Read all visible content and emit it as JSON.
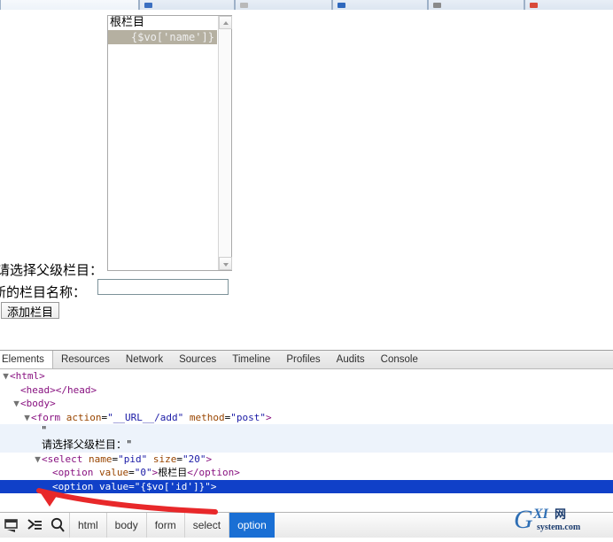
{
  "browser": {
    "tabs": [
      {
        "favicon_color": "#5a7fc4"
      },
      {
        "favicon_color": "#3b6fc0"
      },
      {
        "favicon_color": "#b9b9b9"
      },
      {
        "favicon_color": "#2f68bd"
      },
      {
        "favicon_color": "#8a8a8a"
      },
      {
        "favicon_color": "#d94a3a"
      },
      {
        "favicon_color": "#4d79bf"
      }
    ]
  },
  "page": {
    "select": {
      "name": "pid",
      "size": "20",
      "options": [
        {
          "label": "根栏目",
          "value": "0",
          "selected": false
        },
        {
          "label": "{$vo['name']}",
          "value": "{$vo['id']}",
          "selected": true
        }
      ],
      "scroll_up_icon": "chevron-up-icon",
      "scroll_down_icon": "chevron-down-icon"
    },
    "label_parent": "请选择父级栏目：",
    "label_name": "新的栏目名称：",
    "input_name_value": "",
    "input_name_placeholder": "",
    "submit_label": "添加栏目"
  },
  "devtools": {
    "tabs": [
      {
        "label": "Elements",
        "active": true
      },
      {
        "label": "Resources",
        "active": false
      },
      {
        "label": "Network",
        "active": false
      },
      {
        "label": "Sources",
        "active": false
      },
      {
        "label": "Timeline",
        "active": false
      },
      {
        "label": "Profiles",
        "active": false
      },
      {
        "label": "Audits",
        "active": false
      },
      {
        "label": "Console",
        "active": false
      }
    ],
    "dom_lines": [
      {
        "indent": 0,
        "twisty": "▼",
        "html": "<span class=\"tagp\">&lt;html&gt;</span>",
        "state": "none"
      },
      {
        "indent": 1,
        "twisty": "",
        "html": "<span class=\"tagp\">&lt;head&gt;&lt;/head&gt;</span>",
        "state": "none"
      },
      {
        "indent": 1,
        "twisty": "▼",
        "html": "<span class=\"tagp\">&lt;body&gt;</span>",
        "state": "none"
      },
      {
        "indent": 2,
        "twisty": "▼",
        "html": "<span class=\"tagp\">&lt;form</span> <span class=\"attn\">action</span>=<span class=\"attv\">\"__URL__/add\"</span> <span class=\"attn\">method</span>=<span class=\"attv\">\"post\"</span><span class=\"tagp\">&gt;</span>",
        "state": "none"
      },
      {
        "indent": 3,
        "twisty": "",
        "html": "<span class=\"txtnode\">\"</span>",
        "state": "text"
      },
      {
        "indent": 3,
        "twisty": "",
        "html": "<span class=\"txtnode\">请选择父级栏目：\"</span>",
        "state": "text"
      },
      {
        "indent": 3,
        "twisty": "▼",
        "html": "<span class=\"tagp\">&lt;select</span> <span class=\"attn\">name</span>=<span class=\"attv\">\"pid\"</span> <span class=\"attn\">size</span>=<span class=\"attv\">\"20\"</span><span class=\"tagp\">&gt;</span>",
        "state": "none"
      },
      {
        "indent": 4,
        "twisty": "",
        "html": "<span class=\"tagp\">&lt;option</span> <span class=\"attn\">value</span>=<span class=\"attv\">\"0\"</span><span class=\"tagp\">&gt;</span>根栏目<span class=\"tagp\">&lt;/option&gt;</span>",
        "state": "none"
      },
      {
        "indent": 4,
        "twisty": "",
        "html": "<span class=\"tagp\">&lt;option</span> <span class=\"attn\">value</span>=<span class=\"attv\">\"{$vo['id']}\"</span><span class=\"tagp\">&gt;</span>",
        "state": "selected"
      }
    ],
    "breadcrumb": {
      "inspect_icon": "inspect-element-icon",
      "dock_icon": "dock-panel-icon",
      "search_icon": "search-icon",
      "items": [
        {
          "label": "html",
          "active": false
        },
        {
          "label": "body",
          "active": false
        },
        {
          "label": "form",
          "active": false
        },
        {
          "label": "select",
          "active": false
        },
        {
          "label": "option",
          "active": true
        }
      ]
    }
  },
  "annotation": {
    "arrow_color": "#e8282a",
    "arrow_name": "red-annotation-arrow"
  },
  "watermark": {
    "primary": "G",
    "secondary": "XI",
    "tertiary": "网",
    "subtitle": "system.com",
    "color_blue": "#2f6fb5",
    "color_dark": "#1b3c6e"
  }
}
